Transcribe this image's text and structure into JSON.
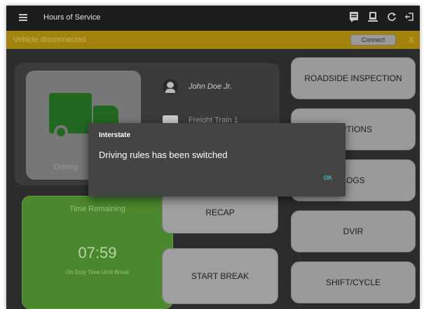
{
  "appbar": {
    "title": "Hours of Service",
    "icons": [
      "menu-icon",
      "document-icon",
      "device-icon",
      "refresh-icon",
      "logout-icon"
    ]
  },
  "banner": {
    "text": "Vehicle disconnected",
    "connect_label": "Connect",
    "close_label": "X",
    "color": "#a6860e"
  },
  "status": {
    "driving_label": "Driving",
    "driver_name": "John Doe Jr.",
    "vehicle_name": "Freight Train 1",
    "truck_color": "#236b22"
  },
  "timer": {
    "title": "Time Remaining",
    "value": "07:59",
    "subtitle": "On Duty Time Until Break",
    "color": "#4c8a2e"
  },
  "buttons": {
    "roadside": "ROADSIDE INSPECTION",
    "options": "OPTIONS",
    "logs": "LOGS",
    "recap": "RECAP",
    "dvir": "DVIR",
    "start_break": "START BREAK",
    "shift_cycle": "SHIFT/CYCLE"
  },
  "dialog": {
    "title": "Interstate",
    "message": "Driving rules has been switched",
    "ok_label": "OK",
    "accent": "#45b6cf"
  }
}
